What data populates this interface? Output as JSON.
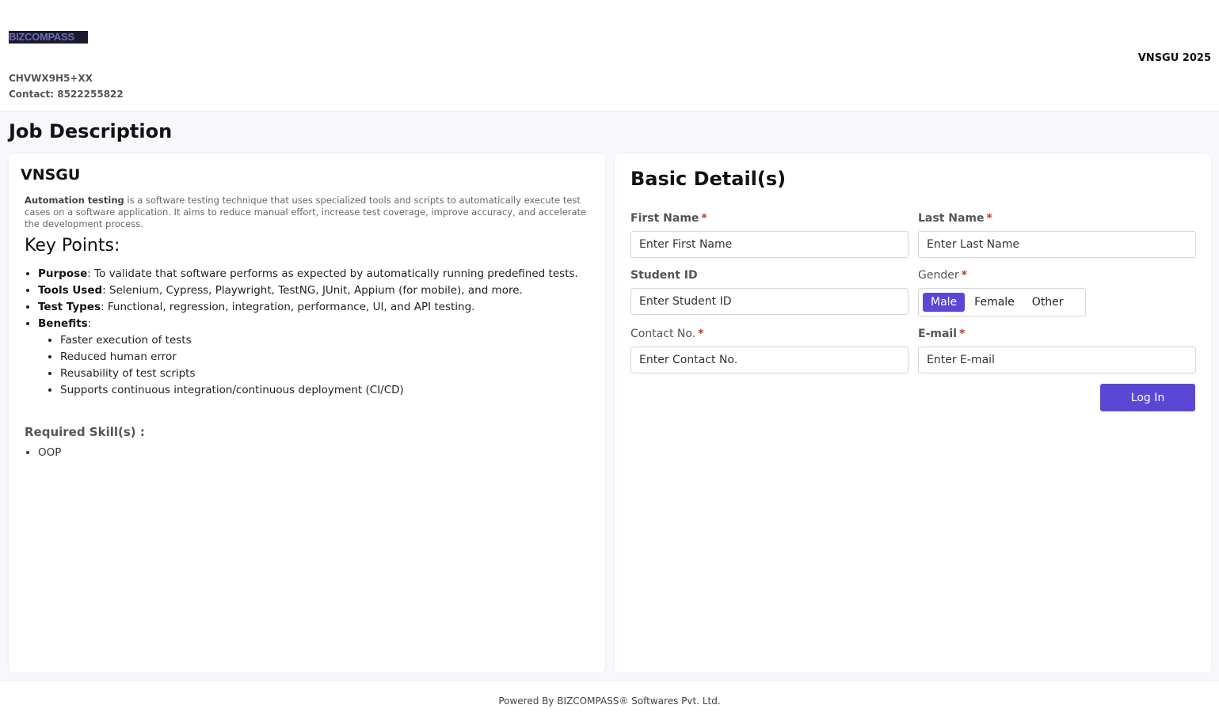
{
  "header": {
    "logo_text": "BIZCOMPASS",
    "code": "CHVWX9H5+XX",
    "contact": "Contact: 8522255822",
    "event": "VNSGU 2025"
  },
  "page_title": "Job Description",
  "job": {
    "org": "VNSGU",
    "intro_term": "Automation testing",
    "intro_rest": " is a software testing technique that uses specialized tools and scripts to automatically execute test cases on a software application. It aims to reduce manual effort, increase test coverage, improve accuracy, and accelerate the development process.",
    "key_points_heading": "Key Points:",
    "points": [
      {
        "term": "Purpose",
        "text": ": To validate that software performs as expected by automatically running predefined tests."
      },
      {
        "term": "Tools Used",
        "text": ": Selenium, Cypress, Playwright, TestNG, JUnit, Appium (for mobile), and more."
      },
      {
        "term": "Test Types",
        "text": ": Functional, regression, integration, performance, UI, and API testing."
      },
      {
        "term": "Benefits",
        "text": ":"
      }
    ],
    "benefits": [
      "Faster execution of tests",
      "Reduced human error",
      "Reusability of test scripts",
      "Supports continuous integration/continuous deployment (CI/CD)"
    ],
    "skills_heading": "Required Skill(s) :",
    "skills": [
      "OOP"
    ]
  },
  "form": {
    "title": "Basic Detail(s)",
    "required_mark": "*",
    "first_name": {
      "label": "First Name",
      "placeholder": "Enter First Name"
    },
    "last_name": {
      "label": "Last Name",
      "placeholder": "Enter Last Name"
    },
    "student_id": {
      "label": "Student ID",
      "placeholder": "Enter Student ID"
    },
    "gender": {
      "label": "Gender",
      "options": [
        "Male",
        "Female",
        "Other"
      ],
      "selected": "Male"
    },
    "contact": {
      "label": "Contact No.",
      "placeholder": "Enter Contact No."
    },
    "email": {
      "label": "E-mail",
      "placeholder": "Enter E-mail"
    },
    "submit_label": "Log In"
  },
  "footer": {
    "text": "Powered By BIZCOMPASS® Softwares Pvt. Ltd."
  },
  "colors": {
    "accent": "#5b47d6",
    "required": "#c0392b"
  }
}
